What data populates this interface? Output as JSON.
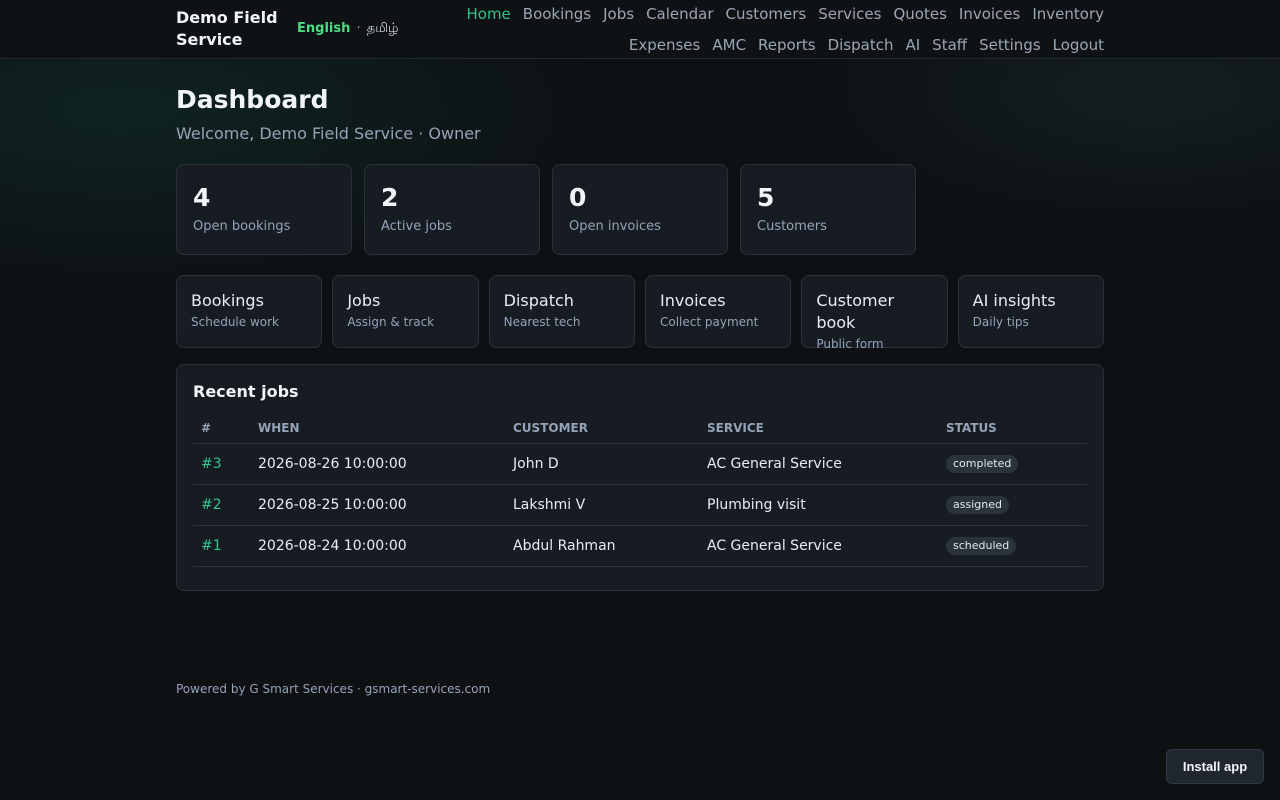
{
  "brand": "Demo Field Service",
  "language": {
    "active": "English",
    "separator": "·",
    "other": "தமிழ்"
  },
  "nav": [
    {
      "label": "Home",
      "active": true
    },
    {
      "label": "Bookings"
    },
    {
      "label": "Jobs"
    },
    {
      "label": "Calendar"
    },
    {
      "label": "Customers"
    },
    {
      "label": "Services"
    },
    {
      "label": "Quotes"
    },
    {
      "label": "Invoices"
    },
    {
      "label": "Inventory"
    },
    {
      "label": "Expenses"
    },
    {
      "label": "AMC"
    },
    {
      "label": "Reports"
    },
    {
      "label": "Dispatch"
    },
    {
      "label": "AI"
    },
    {
      "label": "Staff"
    },
    {
      "label": "Settings"
    },
    {
      "label": "Logout"
    }
  ],
  "page": {
    "title": "Dashboard",
    "welcome": "Welcome, Demo Field Service · Owner"
  },
  "stats": [
    {
      "value": "4",
      "label": "Open bookings"
    },
    {
      "value": "2",
      "label": "Active jobs"
    },
    {
      "value": "0",
      "label": "Open invoices"
    },
    {
      "value": "5",
      "label": "Customers"
    }
  ],
  "tiles": [
    {
      "title": "Bookings",
      "subtitle": "Schedule work"
    },
    {
      "title": "Jobs",
      "subtitle": "Assign & track"
    },
    {
      "title": "Dispatch",
      "subtitle": "Nearest tech"
    },
    {
      "title": "Invoices",
      "subtitle": "Collect payment"
    },
    {
      "title": "Customer book",
      "subtitle": "Public form"
    },
    {
      "title": "AI insights",
      "subtitle": "Daily tips"
    }
  ],
  "recent_jobs": {
    "title": "Recent jobs",
    "columns": [
      "#",
      "WHEN",
      "CUSTOMER",
      "SERVICE",
      "STATUS"
    ],
    "rows": [
      {
        "id": "#3",
        "when": "2026-08-26 10:00:00",
        "customer": "John D",
        "service": "AC General Service",
        "status": "completed"
      },
      {
        "id": "#2",
        "when": "2026-08-25 10:00:00",
        "customer": "Lakshmi V",
        "service": "Plumbing visit",
        "status": "assigned"
      },
      {
        "id": "#1",
        "when": "2026-08-24 10:00:00",
        "customer": "Abdul Rahman",
        "service": "AC General Service",
        "status": "scheduled"
      }
    ]
  },
  "footer": "Powered by G Smart Services · gsmart-services.com",
  "install_button": "Install app",
  "colors": {
    "accent": "#34c28a",
    "lang_active": "#4ade80",
    "background": "#0d1114"
  }
}
